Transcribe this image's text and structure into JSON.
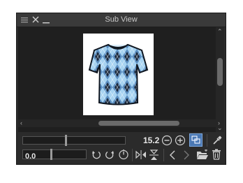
{
  "window": {
    "title": "Sub View"
  },
  "zoom": {
    "value_label": "15.2",
    "slider_fraction": 0.42
  },
  "rotation": {
    "value_label": "0.0",
    "slider_fraction": 0.45
  },
  "icons": {
    "menu": "hamburger-menu-icon",
    "close": "close-icon",
    "minimize": "minimize-icon",
    "zoom_out": "zoom-out-icon",
    "zoom_in": "zoom-in-icon",
    "fit": "fit-to-window-icon",
    "eyedropper": "eyedropper-icon",
    "rotate_left": "rotate-left-icon",
    "rotate_right": "rotate-right-icon",
    "reset_rotation": "reset-rotation-icon",
    "flip_h": "flip-horizontal-icon",
    "flip_v": "flip-vertical-icon",
    "prev": "previous-image-icon",
    "next": "next-image-icon",
    "open": "open-folder-icon",
    "delete": "trash-icon"
  },
  "colors": {
    "panel": "#2b2b2b",
    "accent": "#5b8fd6",
    "shirt_light": "#a7d3f1",
    "shirt_dark": "#1b2b40"
  }
}
